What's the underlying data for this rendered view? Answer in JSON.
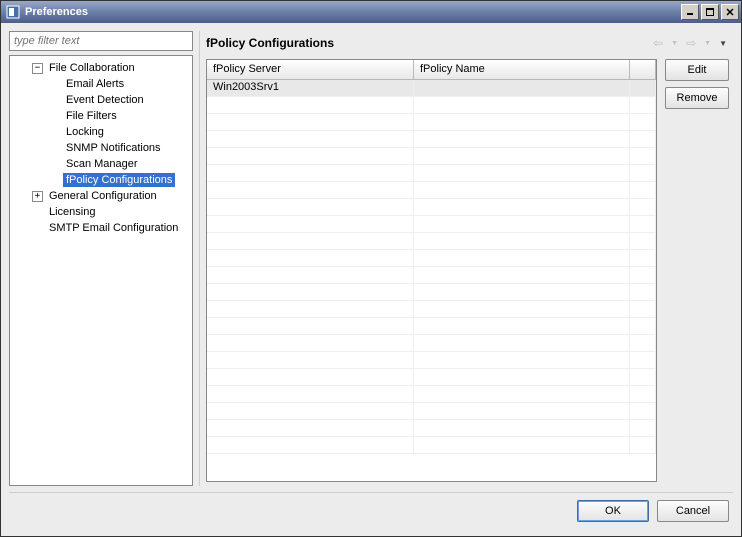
{
  "window": {
    "title": "Preferences"
  },
  "filter": {
    "placeholder": "type filter text"
  },
  "tree": {
    "file_collaboration": {
      "label": "File Collaboration",
      "children": {
        "email_alerts": "Email Alerts",
        "event_detection": "Event Detection",
        "file_filters": "File Filters",
        "locking": "Locking",
        "snmp_notifications": "SNMP Notifications",
        "scan_manager": "Scan Manager",
        "fpolicy_configurations": "fPolicy Configurations"
      }
    },
    "general_configuration": {
      "label": "General Configuration"
    },
    "licensing": {
      "label": "Licensing"
    },
    "smtp_email_configuration": {
      "label": "SMTP Email Configuration"
    }
  },
  "page": {
    "title": "fPolicy Configurations",
    "columns": {
      "server": "fPolicy Server",
      "name": "fPolicy Name"
    },
    "rows": [
      {
        "server": "Win2003Srv1",
        "name": ""
      }
    ],
    "buttons": {
      "edit": "Edit",
      "remove": "Remove"
    }
  },
  "dialog_buttons": {
    "ok": "OK",
    "cancel": "Cancel"
  }
}
